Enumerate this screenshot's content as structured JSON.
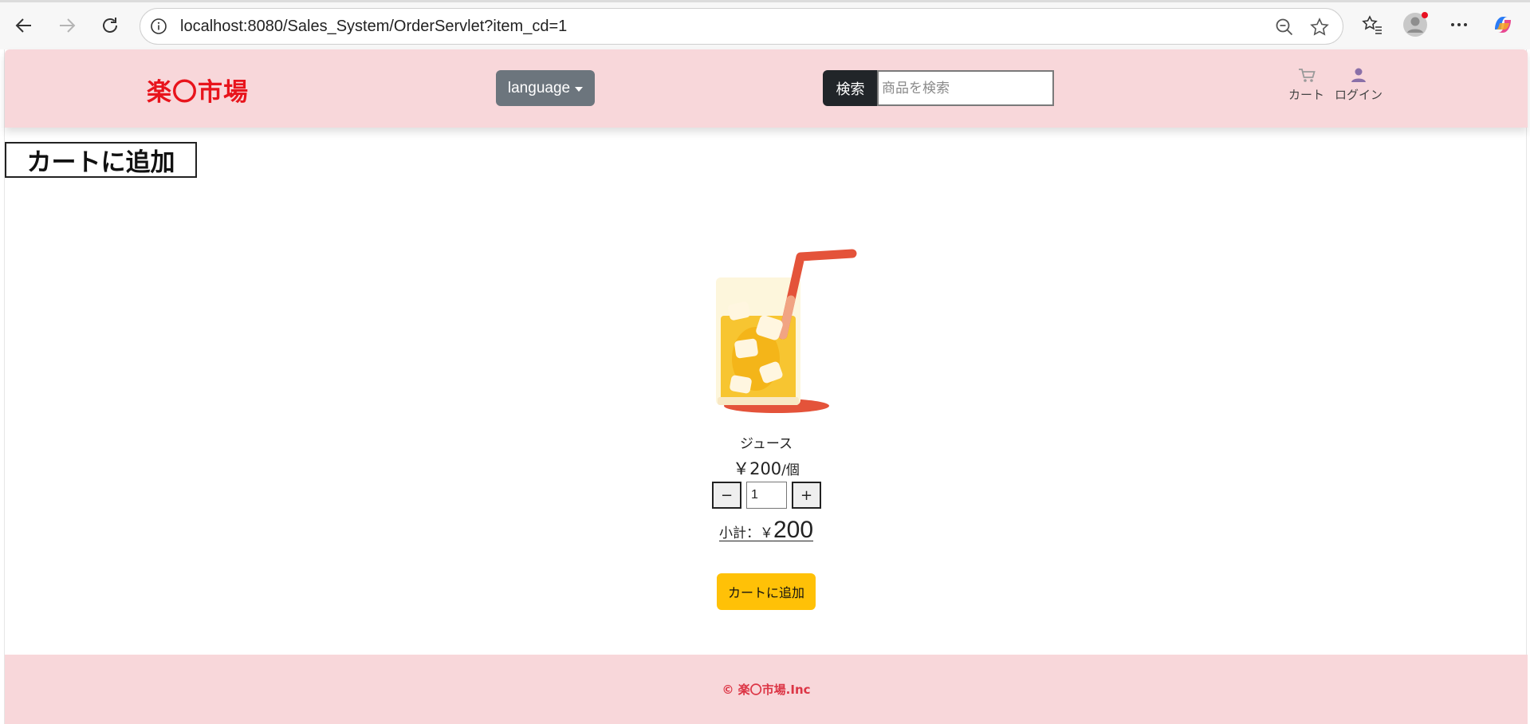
{
  "browser": {
    "url": "localhost:8080/Sales_System/OrderServlet?item_cd=1"
  },
  "header": {
    "logo": "楽〇市場",
    "language_label": "language",
    "search_label": "検索",
    "search_placeholder": "商品を検索",
    "cart_label": "カート",
    "login_label": "ログイン"
  },
  "main": {
    "section_title": "カートに追加",
    "product": {
      "name": "ジュース",
      "price": "￥200",
      "unit": "/個",
      "quantity": "1",
      "minus_label": "−",
      "plus_label": "+",
      "subtotal_label": "小計：￥",
      "subtotal_value": "200"
    },
    "add_to_cart_label": "カートに追加"
  },
  "footer": {
    "copyright": "© 楽〇市場.Inc"
  },
  "colors": {
    "header_bg": "#f8d7da",
    "logo": "#e8141c",
    "language_button": "#6c757d",
    "search_button": "#212529",
    "add_button": "#ffc107",
    "footer_text": "#dc3545"
  }
}
